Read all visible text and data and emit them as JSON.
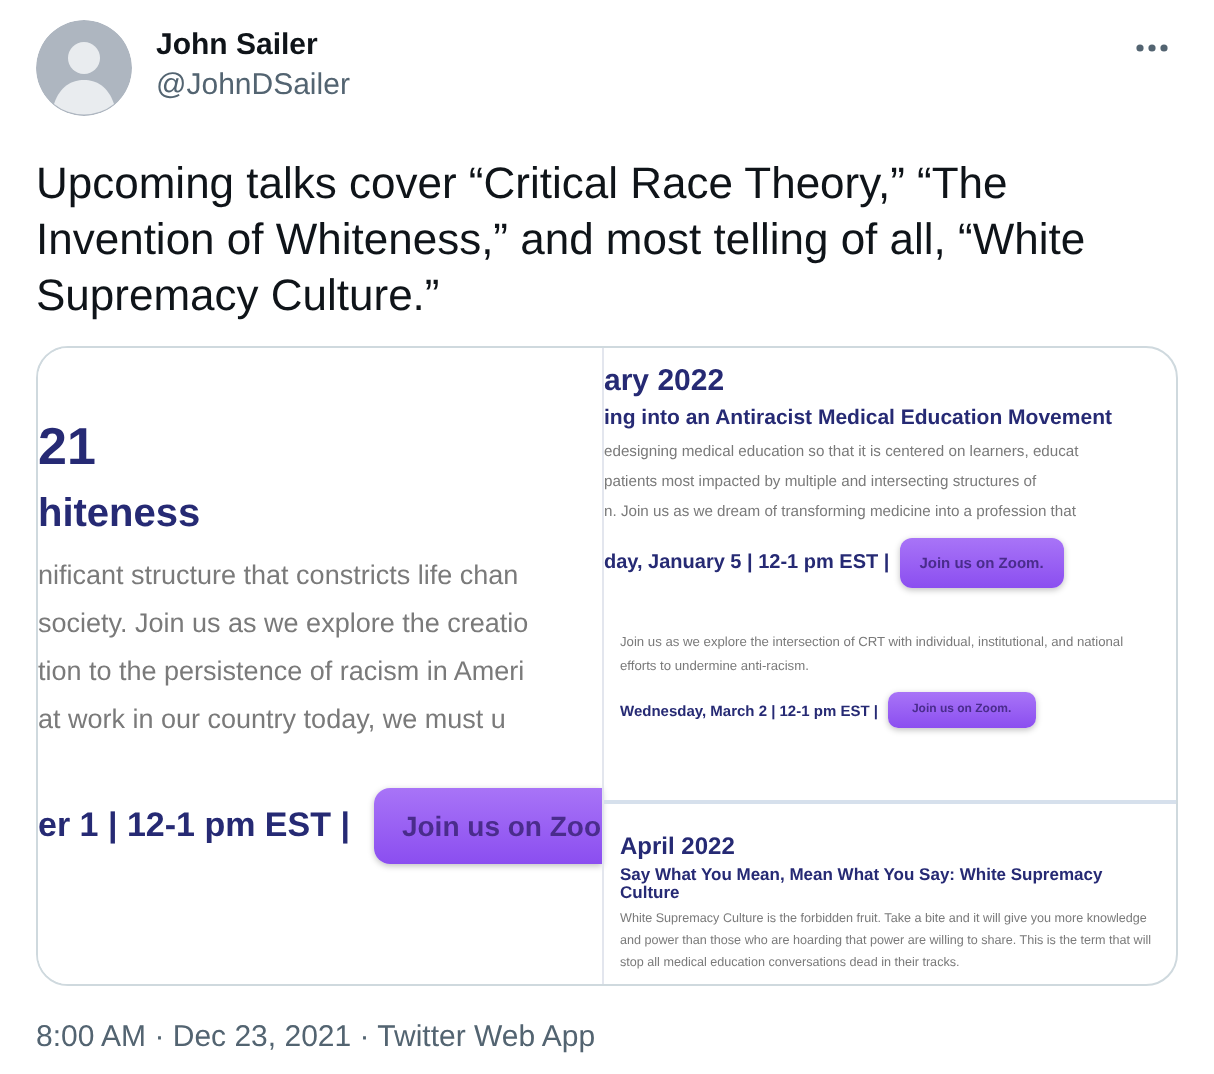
{
  "author": {
    "name": "John Sailer",
    "handle": "@JohnDSailer"
  },
  "text": "Upcoming talks cover “Critical Race Theory,” “The Invention of Whiteness,” and most telling of all, “White Supremacy Culture.”",
  "media": {
    "left": {
      "heading": "21",
      "title": "hiteness",
      "lines": [
        "nificant structure that constricts life chan",
        "society. Join us as we explore the creatio",
        "tion to the persistence of racism in Ameri",
        "at work in our country today, we must u"
      ],
      "schedule": "er 1 | 12-1 pm EST |",
      "button": "Join us on Zoo"
    },
    "right_top": {
      "heading": "ary 2022",
      "title": "ing into an Antiracist Medical Education Movement",
      "lines": [
        "edesigning medical education so that it is centered on learners, educat",
        "patients most impacted by multiple and intersecting structures of",
        "n. Join us as we dream of transforming medicine into a profession that"
      ],
      "schedule": "day, January 5 | 12-1 pm EST |",
      "button": "Join us on Zoom.",
      "events": [
        {
          "description": "Join us as we explore the intersection of CRT with individual, institutional, and national efforts to undermine anti-racism.",
          "schedule": "Wednesday, March 2 | 12-1 pm EST |",
          "button": "Join us on Zoom."
        }
      ]
    },
    "right_bottom": {
      "heading": "April 2022",
      "title": "Say What You Mean, Mean What You Say: White Supremacy Culture",
      "description": "White Supremacy Culture is the forbidden fruit. Take a bite and it will give you more knowledge and power than those who are hoarding that power are willing to share. This is the term that will stop all medical education conversations dead in their tracks."
    }
  },
  "meta": "8:00 AM · Dec 23, 2021 · Twitter Web App"
}
